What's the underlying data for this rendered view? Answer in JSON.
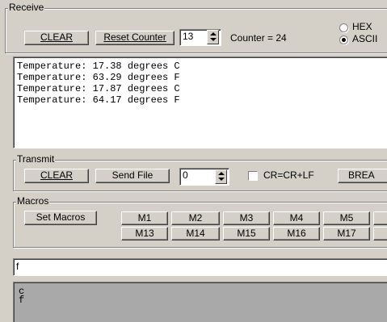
{
  "receive": {
    "group_label": "Receive",
    "clear_label": "CLEAR",
    "reset_counter_label": "Reset Counter",
    "counter_input_value": "13",
    "counter_text": "Counter = 24",
    "hex_label": "HEX",
    "ascii_label": "ASCII",
    "lines": [
      "Temperature: 17.38 degrees C",
      "Temperature: 63.29 degrees F",
      "Temperature: 17.87 degrees C",
      "Temperature: 64.17 degrees F"
    ]
  },
  "transmit": {
    "group_label": "Transmit",
    "clear_label": "CLEAR",
    "send_file_label": "Send File",
    "delay_value": "0",
    "crlf_label": "CR=CR+LF",
    "break_label": "BREA"
  },
  "macros": {
    "group_label": "Macros",
    "set_macros_label": "Set Macros",
    "row1": [
      "M1",
      "M2",
      "M3",
      "M4",
      "M5"
    ],
    "row2": [
      "M13",
      "M14",
      "M15",
      "M16",
      "M17"
    ]
  },
  "send_input": {
    "value": "f"
  },
  "transmit_log": {
    "lines": [
      "c",
      "f"
    ]
  }
}
